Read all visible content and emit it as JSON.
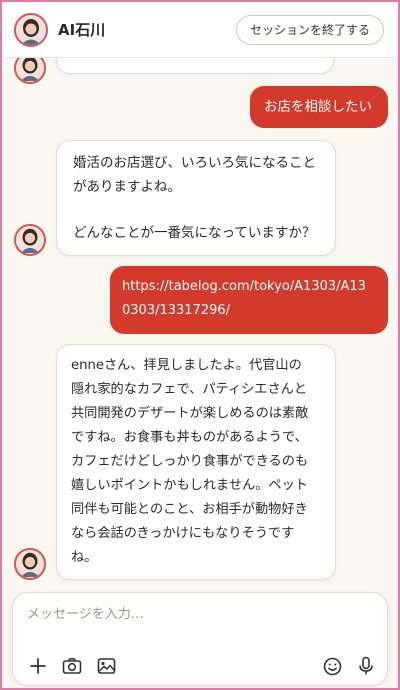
{
  "header": {
    "title": "AI石川",
    "end_session_label": "セッションを終了する"
  },
  "messages": [
    {
      "role": "bot",
      "text": ""
    },
    {
      "role": "user",
      "text": "お店を相談したい"
    },
    {
      "role": "bot",
      "lines": [
        "婚活のお店選び、いろいろ気になること",
        "がありますよね。",
        "",
        "どんなことが一番気になっていますか？"
      ]
    },
    {
      "role": "user",
      "lines": [
        "https://tabelog.com/tokyo/A1303/A13",
        "0303/13317296/"
      ]
    },
    {
      "role": "bot",
      "lines": [
        "enneさん、拝見しましたよ。代官山の",
        "隠れ家的なカフェで、パティシエさんと",
        "共同開発のデザートが楽しめるのは素敵",
        "ですね。お食事も丼ものがあるようで、",
        "カフェだけどしっかり食事ができるのも",
        "嬉しいポイントかもしれません。ペット",
        "同伴も可能とのこと、お相手が動物好き",
        "なら会話のきっかけにもなりそうです",
        "ね。"
      ]
    }
  ],
  "composer": {
    "placeholder": "メッセージを入力…",
    "value": ""
  },
  "icons": [
    "avatar",
    "plus-icon",
    "camera-icon",
    "image-icon",
    "emoji-icon",
    "microphone-icon"
  ],
  "colors": {
    "accent": "#d33a2c",
    "background": "#faf6f0",
    "frame": "#e07aa8"
  }
}
